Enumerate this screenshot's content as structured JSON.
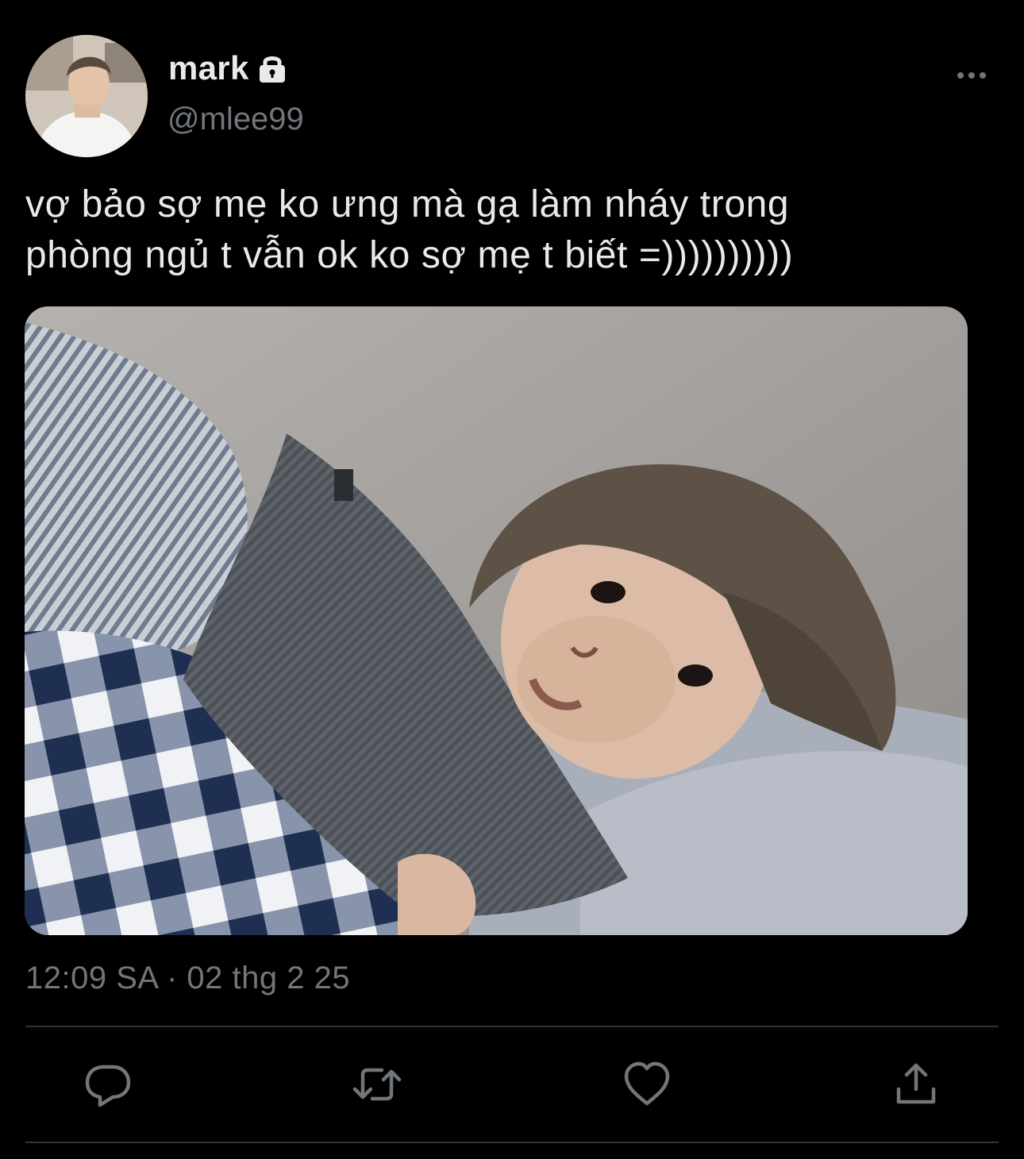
{
  "user": {
    "display_name": "mark",
    "handle": "@mlee99",
    "protected_icon": "lock-icon",
    "avatar": "avatar-photo"
  },
  "tweet": {
    "text_lines": [
      "vợ bảo sợ mẹ ko ưng mà gạ làm nháy trong",
      "phòng ngủ t vẫn ok ko sợ mẹ t biết =))))))))))"
    ],
    "media": "photo-person-lying-in-bed-with-pillow",
    "timestamp": "12:09 SA · 02 thg 2 25"
  },
  "actions": [
    {
      "name": "reply",
      "icon": "reply-icon"
    },
    {
      "name": "retweet",
      "icon": "retweet-icon"
    },
    {
      "name": "like",
      "icon": "heart-icon"
    },
    {
      "name": "share",
      "icon": "share-icon"
    }
  ],
  "colors": {
    "background": "#000000",
    "primary_text": "#e7e9ea",
    "secondary_text": "#71767b",
    "divider": "#2f3336"
  }
}
